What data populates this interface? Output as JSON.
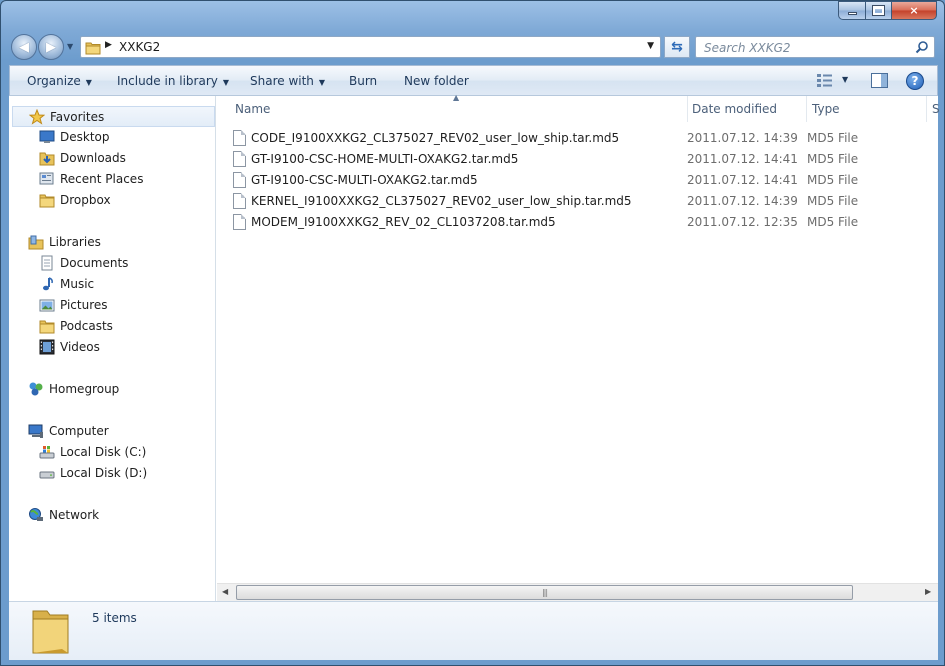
{
  "window": {
    "caption": {
      "minimize": "minimize-icon",
      "maximize": "maximize-icon",
      "close": "×"
    }
  },
  "navigation": {
    "back_icon": "back-arrow-icon",
    "forward_icon": "forward-arrow-icon",
    "address_crumb": "XXKG2",
    "search_placeholder": "Search XXKG2"
  },
  "commandbar": {
    "organize": "Organize",
    "include_in_library": "Include in library",
    "share_with": "Share with",
    "burn": "Burn",
    "new_folder": "New folder"
  },
  "sidebar": {
    "favorites": {
      "label": "Favorites",
      "items": [
        {
          "label": "Desktop"
        },
        {
          "label": "Downloads"
        },
        {
          "label": "Recent Places"
        },
        {
          "label": "Dropbox"
        }
      ]
    },
    "libraries": {
      "label": "Libraries",
      "items": [
        {
          "label": "Documents"
        },
        {
          "label": "Music"
        },
        {
          "label": "Pictures"
        },
        {
          "label": "Podcasts"
        },
        {
          "label": "Videos"
        }
      ]
    },
    "homegroup": {
      "label": "Homegroup"
    },
    "computer": {
      "label": "Computer",
      "items": [
        {
          "label": "Local Disk (C:)"
        },
        {
          "label": "Local Disk (D:)"
        }
      ]
    },
    "network": {
      "label": "Network"
    }
  },
  "file_list": {
    "columns": {
      "name": "Name",
      "date_modified": "Date modified",
      "type": "Type",
      "size": "S"
    },
    "files": [
      {
        "name": "CODE_I9100XXKG2_CL375027_REV02_user_low_ship.tar.md5",
        "date": "2011.07.12. 14:39",
        "type": "MD5 File"
      },
      {
        "name": "GT-I9100-CSC-HOME-MULTI-OXAKG2.tar.md5",
        "date": "2011.07.12. 14:41",
        "type": "MD5 File"
      },
      {
        "name": "GT-I9100-CSC-MULTI-OXAKG2.tar.md5",
        "date": "2011.07.12. 14:41",
        "type": "MD5 File"
      },
      {
        "name": "KERNEL_I9100XXKG2_CL375027_REV02_user_low_ship.tar.md5",
        "date": "2011.07.12. 14:39",
        "type": "MD5 File"
      },
      {
        "name": "MODEM_I9100XXKG2_REV_02_CL1037208.tar.md5",
        "date": "2011.07.12. 12:35",
        "type": "MD5 File"
      }
    ]
  },
  "details": {
    "item_count": "5 items"
  }
}
